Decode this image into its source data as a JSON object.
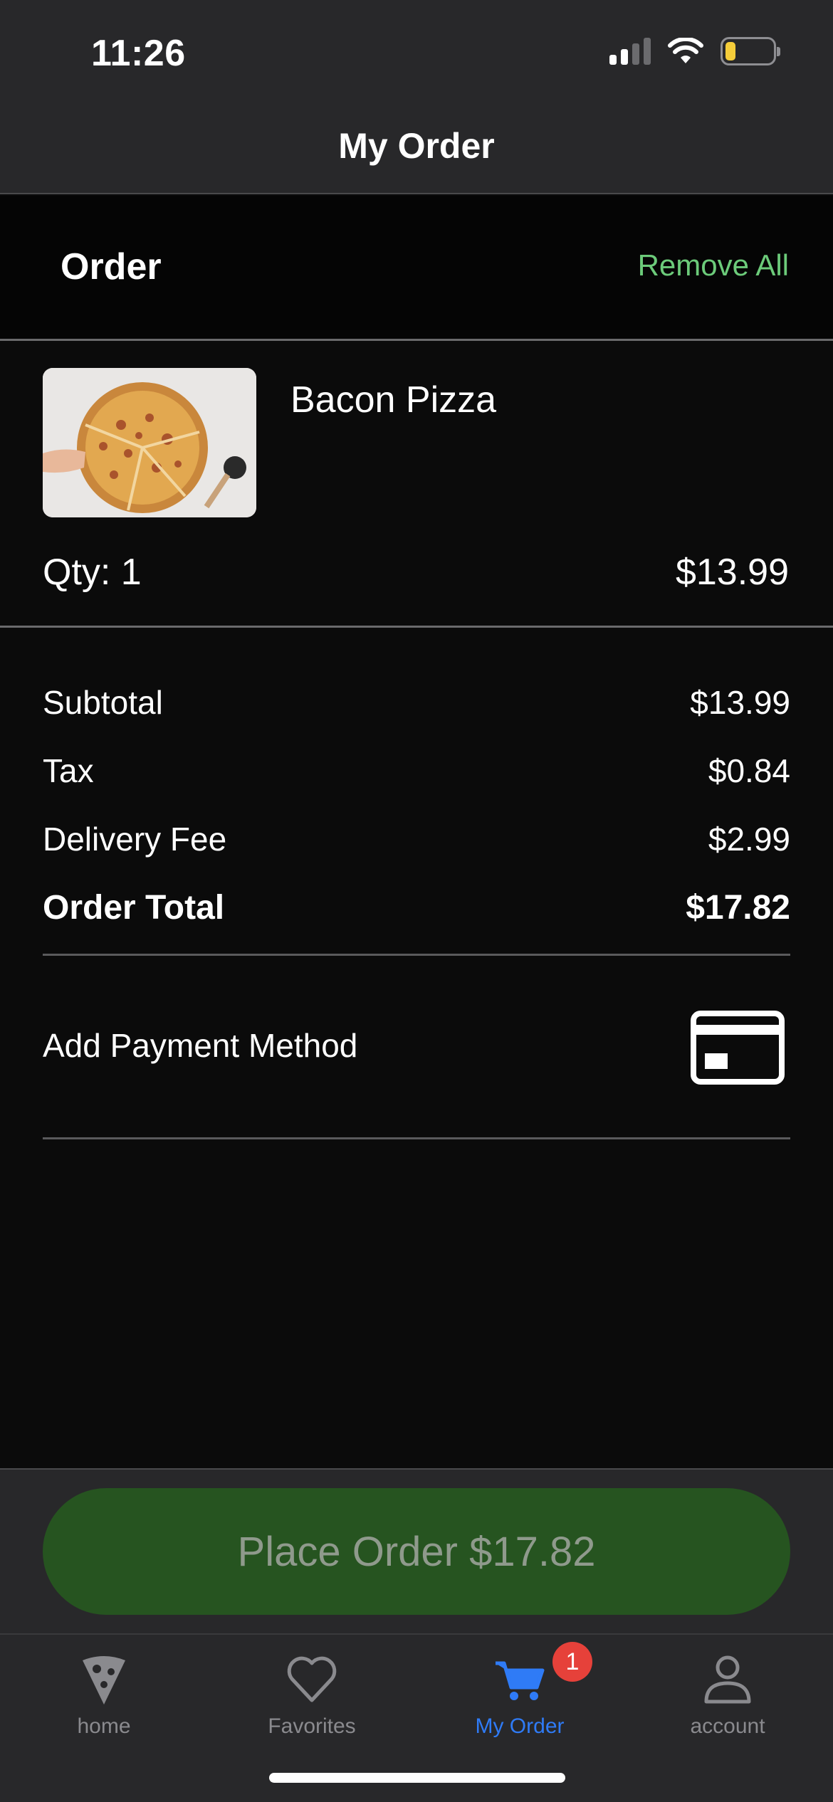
{
  "status_bar": {
    "time": "11:26",
    "icons": [
      "signal-icon",
      "wifi-icon",
      "battery-icon"
    ]
  },
  "header": {
    "title": "My Order"
  },
  "order": {
    "heading": "Order",
    "remove_all_label": "Remove All",
    "accent_color": "#6ccb7a",
    "items": [
      {
        "name": "Bacon Pizza",
        "qty_label": "Qty: 1",
        "price": "$13.99",
        "image": "bacon-pizza-photo"
      }
    ]
  },
  "summary": {
    "subtotal_label": "Subtotal",
    "subtotal_value": "$13.99",
    "tax_label": "Tax",
    "tax_value": "$0.84",
    "delivery_label": "Delivery Fee",
    "delivery_value": "$2.99",
    "total_label": "Order Total",
    "total_value": "$17.82"
  },
  "payment": {
    "label": "Add Payment Method",
    "icon": "credit-card-icon"
  },
  "cta": {
    "label": "Place Order $17.82",
    "color": "#265420"
  },
  "tabbar": {
    "active_color": "#2f7bf6",
    "tabs": [
      {
        "label": "home",
        "icon": "pizza-slice-icon"
      },
      {
        "label": "Favorites",
        "icon": "heart-icon"
      },
      {
        "label": "My Order",
        "icon": "cart-icon",
        "badge": "1"
      },
      {
        "label": "account",
        "icon": "person-icon"
      }
    ]
  }
}
